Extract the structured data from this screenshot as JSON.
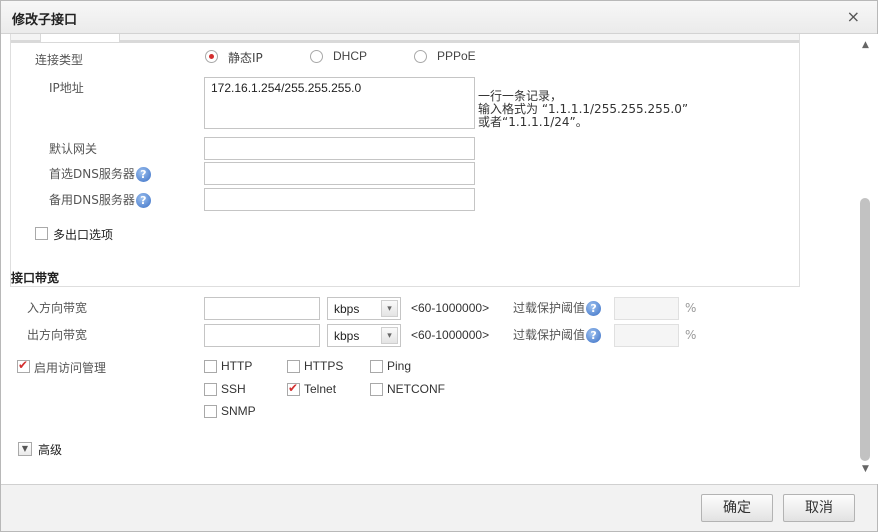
{
  "dialog": {
    "title": "修改子接口",
    "close_icon": "×"
  },
  "connection": {
    "label": "连接类型",
    "options": [
      "静态IP",
      "DHCP",
      "PPPoE"
    ],
    "selected": "静态IP"
  },
  "ip": {
    "label": "IP地址",
    "value": "172.16.1.254/255.255.255.0",
    "hint_line1": "一行一条记录，",
    "hint_line2": "输入格式为 “1.1.1.1/255.255.255.0”",
    "hint_line3": "或者“1.1.1.1/24”。"
  },
  "gateway": {
    "label": "默认网关",
    "value": ""
  },
  "dns_primary": {
    "label": "首选DNS服务器",
    "value": ""
  },
  "dns_secondary": {
    "label": "备用DNS服务器",
    "value": ""
  },
  "multi_exit": {
    "label": "多出口选项",
    "checked": false
  },
  "bandwidth": {
    "section_title": "接口带宽",
    "inbound": {
      "label": "入方向带宽",
      "value": "",
      "unit": "kbps",
      "range": "<60-1000000>",
      "threshold_label": "过载保护阈值",
      "threshold_value": "",
      "percent": "%"
    },
    "outbound": {
      "label": "出方向带宽",
      "value": "",
      "unit": "kbps",
      "range": "<60-1000000>",
      "threshold_label": "过载保护阈值",
      "threshold_value": "",
      "percent": "%"
    }
  },
  "access": {
    "label": "启用访问管理",
    "enabled": true,
    "protocols": [
      {
        "name": "HTTP",
        "checked": false
      },
      {
        "name": "HTTPS",
        "checked": false
      },
      {
        "name": "Ping",
        "checked": false
      },
      {
        "name": "SSH",
        "checked": false
      },
      {
        "name": "Telnet",
        "checked": true
      },
      {
        "name": "NETCONF",
        "checked": false
      },
      {
        "name": "SNMP",
        "checked": false
      }
    ]
  },
  "advanced": {
    "label": "高级",
    "toggle_icon": "▼"
  },
  "help_icon": "?",
  "dropdown_icon": "▾",
  "scroll": {
    "up_icon": "▲",
    "down_icon": "▼"
  },
  "footer": {
    "ok_label": "确定",
    "cancel_label": "取消"
  },
  "colors": {
    "accent": "#d32f2f",
    "help": "#3a6fc5"
  }
}
